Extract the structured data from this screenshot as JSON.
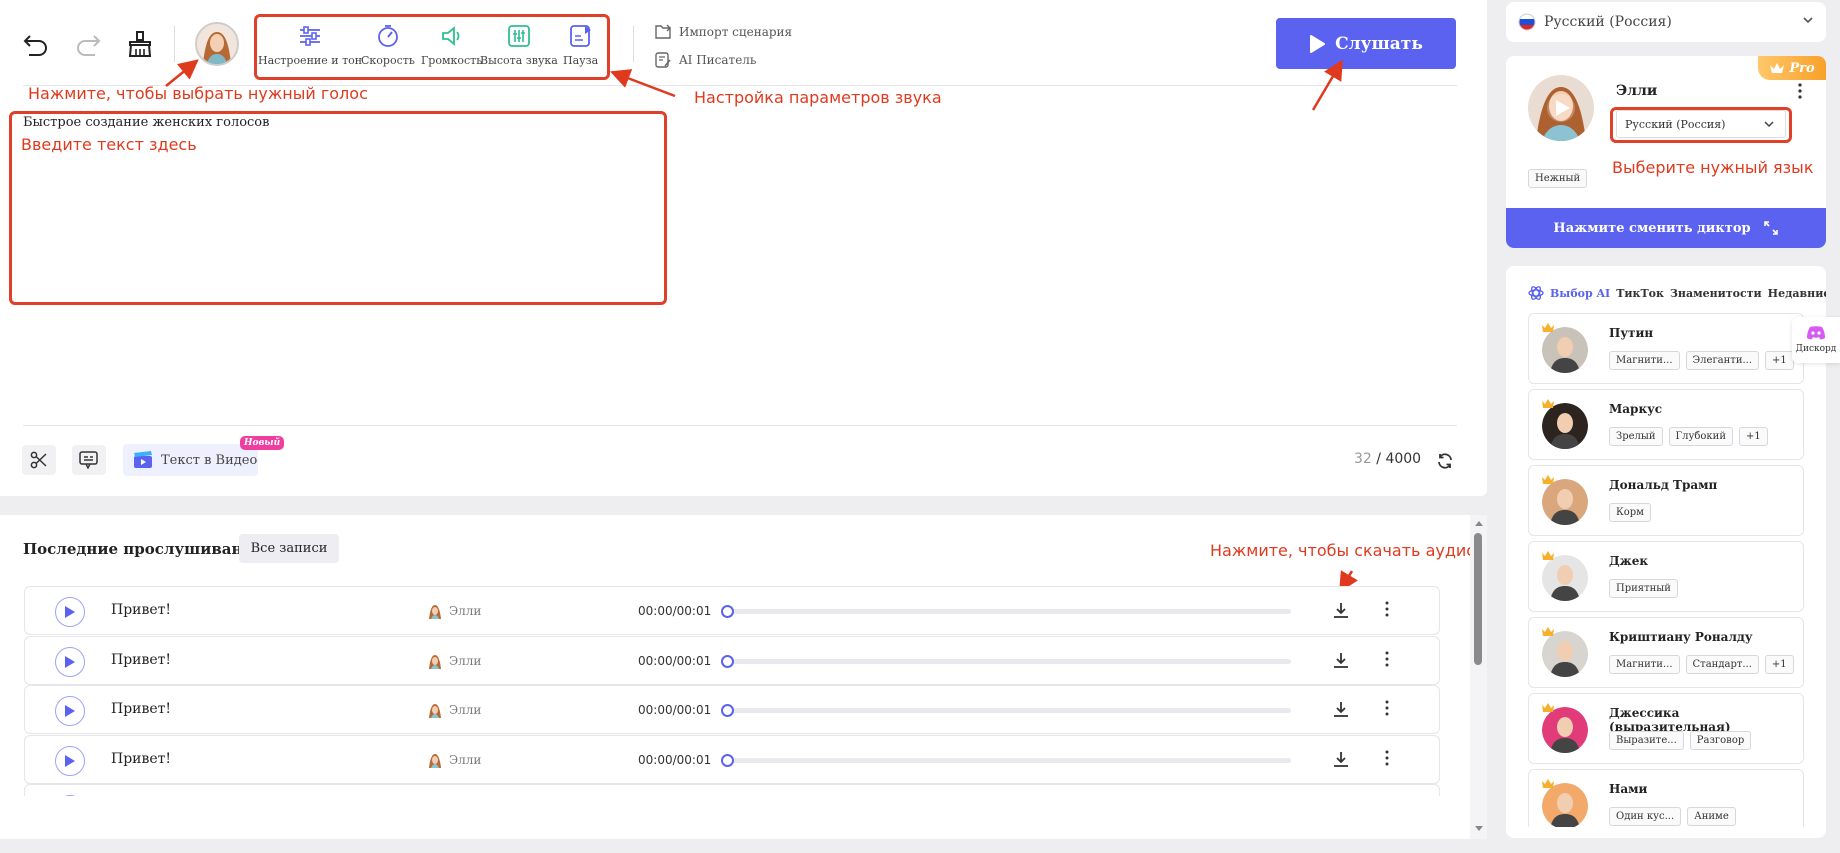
{
  "toolbar": {
    "options": [
      {
        "label": "Настроение и тон",
        "icon": "sliders-icon"
      },
      {
        "label": "Скорость",
        "icon": "speedometer-icon"
      },
      {
        "label": "Громкость",
        "icon": "volume-icon"
      },
      {
        "label": "Высота звука",
        "icon": "equalizer-icon"
      },
      {
        "label": "Пауза",
        "icon": "pause-doc-icon"
      }
    ],
    "import_label": "Импорт сценария",
    "ai_writer_label": "AI Писатель",
    "listen_label": "Слушать"
  },
  "annotations": {
    "voice": "Нажмите, чтобы выбрать нужный голос",
    "params": "Настройка параметров звука",
    "text": "Введите текст здесь",
    "download": "Нажмите, чтобы скачать аудио",
    "language": "Выберите нужный язык"
  },
  "editor": {
    "text": "Быстрое создание женских голосов",
    "video_label": "Текст в Видео",
    "new_badge": "Новый",
    "count": "32",
    "max": "/ 4000"
  },
  "history": {
    "title": "Последние прослушивания",
    "all_button": "Все записи",
    "rows": [
      {
        "text": "Привет!",
        "voice": "Элли",
        "time": "00:00/00:01",
        "progress": 0
      },
      {
        "text": "Привет!",
        "voice": "Элли",
        "time": "00:00/00:01",
        "progress": 0
      },
      {
        "text": "Привет!",
        "voice": "Элли",
        "time": "00:00/00:01",
        "progress": 0
      },
      {
        "text": "Привет!",
        "voice": "Элли",
        "time": "00:00/00:01",
        "progress": 0
      }
    ]
  },
  "right": {
    "language_top": "Русский (Россия)",
    "pro_badge": "Pro",
    "speaker_name": "Элли",
    "speaker_lang": "Русский (Россия)",
    "speaker_tag": "Нежный",
    "change_speaker": "Нажмите сменить диктор",
    "tabs": [
      "Выбор AI",
      "ТикТок",
      "Знаменитости",
      "Недавние"
    ],
    "discord": "Дискорд",
    "voices": [
      {
        "name": "Путин",
        "tags": [
          "Магнити...",
          "Элеганти...",
          "+1"
        ],
        "bg": "#c9c2b8"
      },
      {
        "name": "Маркус",
        "tags": [
          "Зрелый",
          "Глубокий",
          "+1"
        ],
        "bg": "#2d2420"
      },
      {
        "name": "Дональд Трамп",
        "tags": [
          "Корм"
        ],
        "bg": "#d9a77b"
      },
      {
        "name": "Джек",
        "tags": [
          "Приятный"
        ],
        "bg": "#e5e5e5"
      },
      {
        "name": "Криштиану Роналду",
        "tags": [
          "Магнити...",
          "Стандарт...",
          "+1"
        ],
        "bg": "#d8d4cf"
      },
      {
        "name": "Джессика (выразительная)",
        "tags": [
          "Выразите...",
          "Разговор"
        ],
        "bg": "#e23b7a"
      },
      {
        "name": "Нами",
        "tags": [
          "Один кус...",
          "Аниме"
        ],
        "bg": "#f3a96a"
      }
    ]
  },
  "colors": {
    "accent": "#5b62f0",
    "annotation": "#e03a1e"
  }
}
